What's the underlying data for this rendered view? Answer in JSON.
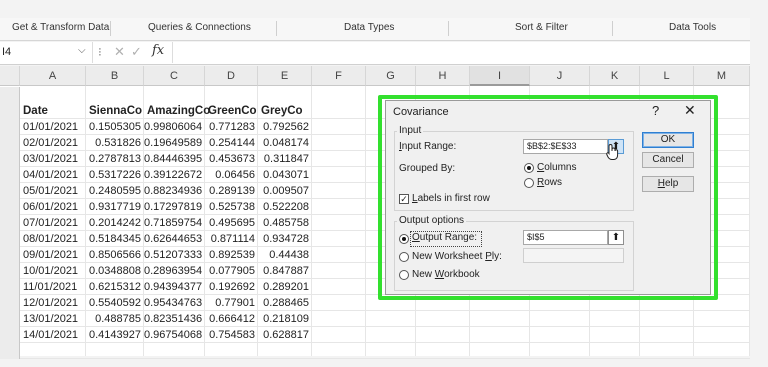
{
  "ribbon": {
    "groups": [
      "Get & Transform Data",
      "Queries & Connections",
      "Data Types",
      "Sort & Filter",
      "Data Tools"
    ]
  },
  "formula_bar": {
    "name_box": "I4",
    "fx_label": "fx",
    "formula": ""
  },
  "sheet": {
    "columns": [
      "A",
      "B",
      "C",
      "D",
      "E",
      "F",
      "G",
      "H",
      "I",
      "J",
      "K",
      "L",
      "M"
    ],
    "selected_column": "I",
    "row_numbers": [
      "",
      "",
      "",
      "",
      "",
      "",
      "",
      "",
      "",
      "",
      "",
      "",
      "",
      "",
      "",
      ""
    ],
    "headers": [
      "Date",
      "SiennaCo",
      "AmazingCo",
      "GreenCo",
      "GreyCo"
    ],
    "rows": [
      [
        "01/01/2021",
        "0.1505305",
        "0.99806064",
        "0.771283",
        "0.792562"
      ],
      [
        "02/01/2021",
        "0.531826",
        "0.19649589",
        "0.254144",
        "0.048174"
      ],
      [
        "03/01/2021",
        "0.2787813",
        "0.84446395",
        "0.453673",
        "0.311847"
      ],
      [
        "04/01/2021",
        "0.5317226",
        "0.39122672",
        "0.06456",
        "0.043071"
      ],
      [
        "05/01/2021",
        "0.2480595",
        "0.88234936",
        "0.289139",
        "0.009507"
      ],
      [
        "06/01/2021",
        "0.9317719",
        "0.17297819",
        "0.525738",
        "0.522208"
      ],
      [
        "07/01/2021",
        "0.2014242",
        "0.71859754",
        "0.495695",
        "0.485758"
      ],
      [
        "08/01/2021",
        "0.5184345",
        "0.62644653",
        "0.871114",
        "0.934728"
      ],
      [
        "09/01/2021",
        "0.8506566",
        "0.51207333",
        "0.892539",
        "0.44438"
      ],
      [
        "10/01/2021",
        "0.0348808",
        "0.28963954",
        "0.077905",
        "0.847887"
      ],
      [
        "11/01/2021",
        "0.6215312",
        "0.94394377",
        "0.192692",
        "0.289201"
      ],
      [
        "12/01/2021",
        "0.5540592",
        "0.95434763",
        "0.77901",
        "0.288465"
      ],
      [
        "13/01/2021",
        "0.488785",
        "0.82351436",
        "0.666412",
        "0.218109"
      ],
      [
        "14/01/2021",
        "0.4143927",
        "0.96754068",
        "0.754583",
        "0.628817"
      ]
    ]
  },
  "dialog": {
    "title": "Covariance",
    "help": "?",
    "close": "✕",
    "input_legend": "Input",
    "input_range_label": "Input Range:",
    "input_range_value": "$B$2:$E$33",
    "grouped_by_label": "Grouped By:",
    "grouped_options": [
      "Columns",
      "Rows"
    ],
    "grouped_selected": "Columns",
    "labels_first_row": "Labels in first row",
    "labels_checked": true,
    "output_legend": "Output options",
    "output_range_label": "Output Range:",
    "output_range_value": "$I$5",
    "new_ply_label": "New Worksheet Ply:",
    "new_ply_value": "",
    "new_workbook_label": "New Workbook",
    "output_selected": "Output Range",
    "buttons": {
      "ok": "OK",
      "cancel": "Cancel",
      "help": "Help"
    }
  },
  "colors": {
    "highlight_frame": "#33e02e",
    "dialog_bg": "#f0f0f0",
    "grid_line": "#e6e6e6"
  }
}
